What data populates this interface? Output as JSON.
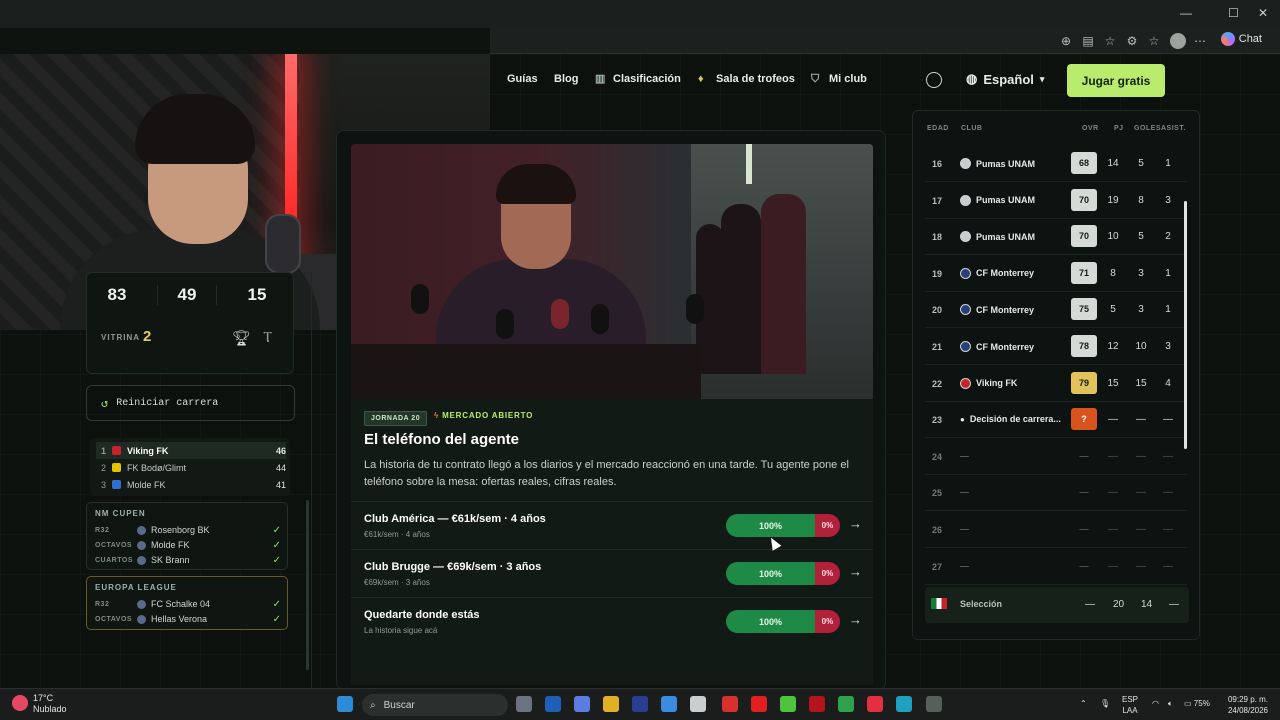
{
  "window": {
    "minimize": "—",
    "maximize": "☐",
    "close": "✕"
  },
  "browser": {
    "chat_label": "Chat"
  },
  "nav": {
    "guides": "Guías",
    "blog": "Blog",
    "ranking": "Clasificación",
    "trophies": "Sala de trofeos",
    "myclub": "Mi club",
    "language": "Español",
    "play": "Jugar gratis"
  },
  "stats": {
    "pj": "83",
    "goles": "49",
    "asist": "15",
    "vitrina_label": "VITRINA",
    "vitrina": "2"
  },
  "restart_label": "Reiniciar carrera",
  "league_table": [
    {
      "pos": "1",
      "team": "Viking FK",
      "pts": "46",
      "color": "#c8232c"
    },
    {
      "pos": "2",
      "team": "FK Bodø/Glimt",
      "pts": "44",
      "color": "#e6c200"
    },
    {
      "pos": "3",
      "team": "Molde FK",
      "pts": "41",
      "color": "#2f6fd0"
    }
  ],
  "cups": [
    {
      "name": "NM CUPEN",
      "rows": [
        {
          "round": "R32",
          "team": "Rosenborg BK",
          "check": "✓"
        },
        {
          "round": "OCTAVOS",
          "team": "Molde FK",
          "check": "✓"
        },
        {
          "round": "CUARTOS",
          "team": "SK Brann",
          "check": "✓"
        }
      ]
    },
    {
      "name": "EUROPA LEAGUE",
      "rows": [
        {
          "round": "R32",
          "team": "FC Schalke 04",
          "check": "✓"
        },
        {
          "round": "OCTAVOS",
          "team": "Hellas Verona",
          "check": "✓"
        }
      ]
    }
  ],
  "story": {
    "round_tag": "JORNADA 20",
    "market_tag": "MERCADO ABIERTO",
    "title": "El teléfono del agente",
    "description": "La historia de tu contrato llegó a los diarios y el mercado reaccionó en una tarde. Tu agente pone el teléfono sobre la mesa: ofertas reales, cifras reales."
  },
  "offers": [
    {
      "title": "Club América — €61k/sem · 4 años",
      "sub": "€61k/sem · 4 años",
      "yes": "100%",
      "no": "0%",
      "arrow": "→"
    },
    {
      "title": "Club Brugge — €69k/sem · 3 años",
      "sub": "€69k/sem · 3 años",
      "yes": "100%",
      "no": "0%",
      "arrow": "→"
    },
    {
      "title": "Quedarte donde estás",
      "sub": "La historia sigue acá",
      "yes": "100%",
      "no": "0%",
      "arrow": "→"
    }
  ],
  "career_table": {
    "headers": {
      "age": "EDAD",
      "club": "CLUB",
      "ovr": "OVR",
      "pj": "PJ",
      "goals": "GOLES",
      "assists": "ASIST."
    },
    "rows": [
      {
        "age": "16",
        "club": "Pumas UNAM",
        "ovr": "68",
        "pj": "14",
        "g": "5",
        "a": "1"
      },
      {
        "age": "17",
        "club": "Pumas UNAM",
        "ovr": "70",
        "pj": "19",
        "g": "8",
        "a": "3"
      },
      {
        "age": "18",
        "club": "Pumas UNAM",
        "ovr": "70",
        "pj": "10",
        "g": "5",
        "a": "2"
      },
      {
        "age": "19",
        "club": "CF Monterrey",
        "ovr": "71",
        "pj": "8",
        "g": "3",
        "a": "1"
      },
      {
        "age": "20",
        "club": "CF Monterrey",
        "ovr": "75",
        "pj": "5",
        "g": "3",
        "a": "1"
      },
      {
        "age": "21",
        "club": "CF Monterrey",
        "ovr": "78",
        "pj": "12",
        "g": "10",
        "a": "3"
      },
      {
        "age": "22",
        "club": "Viking FK",
        "ovr": "79",
        "pj": "15",
        "g": "15",
        "a": "4"
      },
      {
        "age": "23",
        "club": "Decisión de carrera...",
        "ovr": "?",
        "pj": "—",
        "g": "—",
        "a": "—"
      },
      {
        "age": "24",
        "club": "—",
        "ovr": "—",
        "pj": "—",
        "g": "—",
        "a": "—"
      },
      {
        "age": "25",
        "club": "—",
        "ovr": "—",
        "pj": "—",
        "g": "—",
        "a": "—"
      },
      {
        "age": "26",
        "club": "—",
        "ovr": "—",
        "pj": "—",
        "g": "—",
        "a": "—"
      },
      {
        "age": "27",
        "club": "—",
        "ovr": "—",
        "pj": "—",
        "g": "—",
        "a": "—"
      }
    ],
    "selection": {
      "label": "Selección",
      "ovr": "—",
      "pj": "20",
      "g": "14",
      "a": "—"
    }
  },
  "taskbar": {
    "temp": "17°C",
    "weather": "Nublado",
    "search": "Buscar",
    "lang1": "ESP",
    "lang2": "LAA",
    "battery": "75%",
    "time": "09:29 p. m.",
    "date": "24/08/2026"
  },
  "colors": {
    "accent": "#b9ec6d",
    "yes": "#1f8a45",
    "no": "#b2203a",
    "ovr_gold": "#e2c25a",
    "decision": "#d9531e"
  }
}
